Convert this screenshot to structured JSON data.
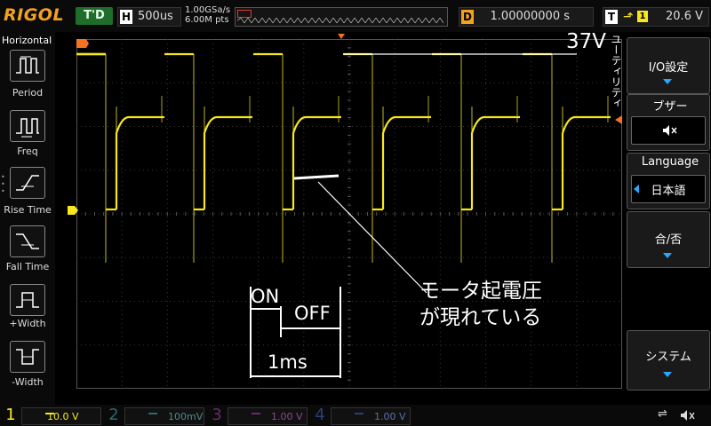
{
  "top_bar": {
    "brand": "RIGOL",
    "run_state": "T'D",
    "horizontal_label": "H",
    "timebase": "500us",
    "sample_rate": "1.00GSa/s",
    "memory_depth": "6.00M pts",
    "delay_label": "D",
    "delay": "1.00000000 s",
    "trigger_label": "T",
    "trigger_source": "1",
    "trigger_level": "20.6 V"
  },
  "left_panel": {
    "title": "Horizontal",
    "items": [
      {
        "label": "Period",
        "icon": "period-icon"
      },
      {
        "label": "Freq",
        "icon": "frequency-icon"
      },
      {
        "label": "Rise Time",
        "icon": "rise-time-icon"
      },
      {
        "label": "Fall Time",
        "icon": "fall-time-icon"
      },
      {
        "label": "+Width",
        "icon": "positive-width-icon"
      },
      {
        "label": "-Width",
        "icon": "negative-width-icon"
      }
    ]
  },
  "right_menu": {
    "side_tab": "ユーティリティ",
    "io_label": "I/O設定",
    "buzzer_label": "ブザー",
    "buzzer_icon": "speaker-muted-icon",
    "language_label": "Language",
    "language_value": "日本語",
    "pass_fail_label": "合/否",
    "system_label": "システム"
  },
  "annotations": {
    "voltage": "37V",
    "motor_emf_line1": "モータ起電圧",
    "motor_emf_line2": "が現れている",
    "on": "ON",
    "off": "OFF",
    "period": "1ms"
  },
  "channels": [
    {
      "num": "1",
      "scale": "10.0 V",
      "color": "#f7e71c",
      "active": true
    },
    {
      "num": "2",
      "scale": "100mV",
      "color": "#29d8d8",
      "active": false
    },
    {
      "num": "3",
      "scale": "1.00 V",
      "color": "#e040e0",
      "active": false
    },
    {
      "num": "4",
      "scale": "1.00 V",
      "color": "#2f6bff",
      "active": false
    }
  ],
  "colors": {
    "ch1": "#f7e71c",
    "brand": "#f3a21f",
    "trigger_marker": "#f37321",
    "menu_accent": "#29a8ff"
  }
}
